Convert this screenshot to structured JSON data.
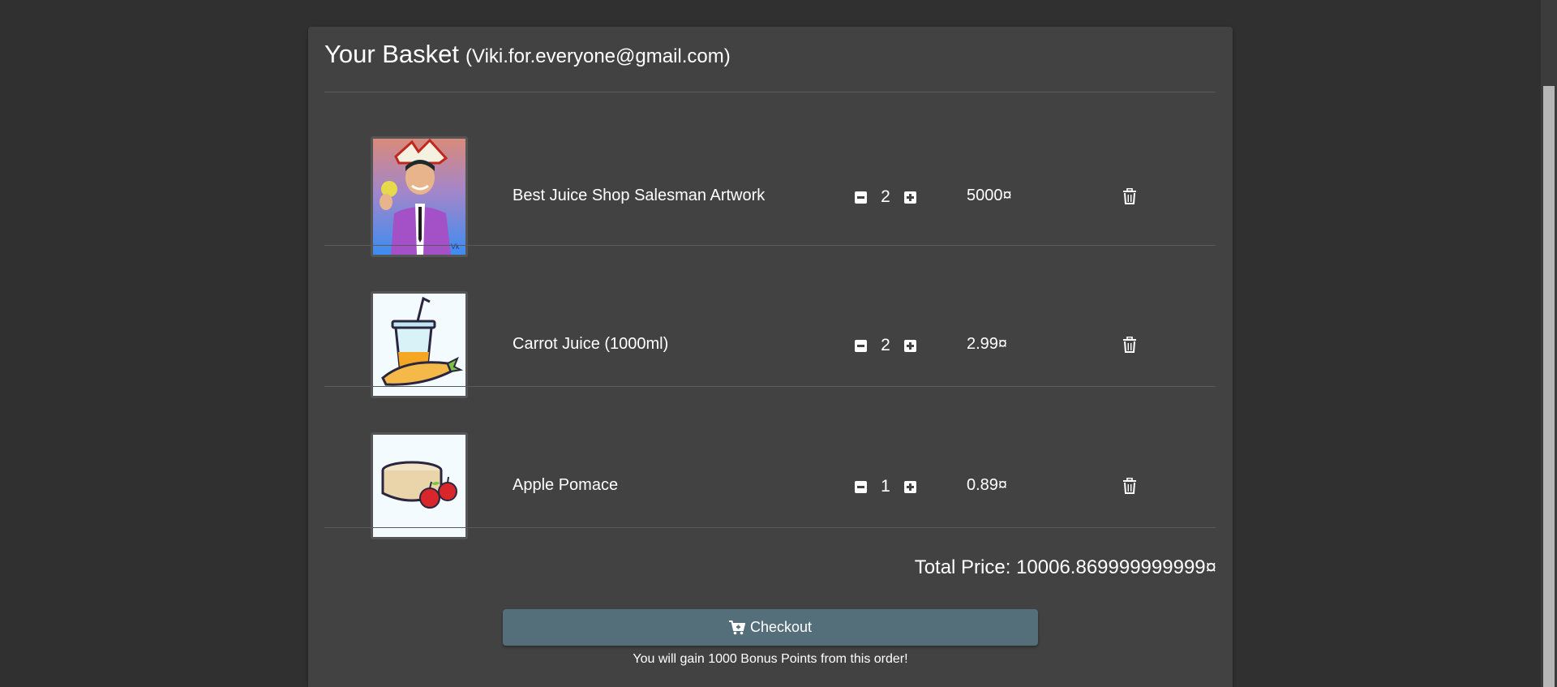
{
  "basket": {
    "title": "Your Basket",
    "email": "(Viki.for.everyone@gmail.com)",
    "items": [
      {
        "name": "Best Juice Shop Salesman Artwork",
        "quantity": "2",
        "price": "5000¤",
        "image_icon": "salesman-artwork-image"
      },
      {
        "name": "Carrot Juice (1000ml)",
        "quantity": "2",
        "price": "2.99¤",
        "image_icon": "carrot-juice-image"
      },
      {
        "name": "Apple Pomace",
        "quantity": "1",
        "price": "0.89¤",
        "image_icon": "apple-pomace-image"
      }
    ],
    "total_price": "Total Price: 10006.869999999999¤",
    "checkout_label": "Checkout",
    "bonus_text": "You will gain 1000 Bonus Points from this order!"
  },
  "colors": {
    "background": "#303030",
    "card": "#424242",
    "checkout_button": "#546e7a"
  },
  "icons": {
    "decrease": "minus-square-icon",
    "increase": "plus-square-icon",
    "remove": "trash-icon",
    "checkout": "cart-plus-icon"
  }
}
